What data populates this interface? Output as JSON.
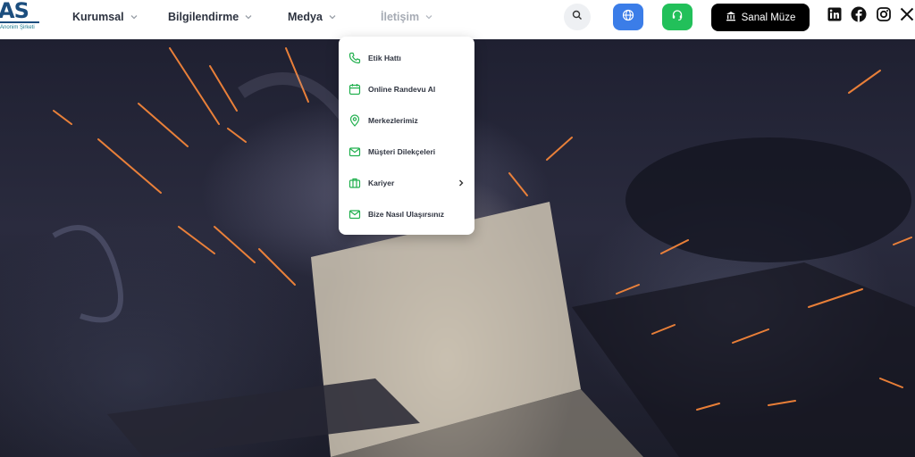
{
  "brand": {
    "logo_mark": "AS",
    "logo_sub": "Anonim Şirketi"
  },
  "nav": {
    "items": [
      {
        "label": "Kurumsal"
      },
      {
        "label": "Bilgilendirme"
      },
      {
        "label": "Medya"
      },
      {
        "label": "İletişim"
      }
    ]
  },
  "header_actions": {
    "museum_label": "Sanal Müze",
    "icons": [
      "search-icon",
      "globe-icon",
      "headset-icon",
      "museum-icon"
    ]
  },
  "social": [
    "linkedin-icon",
    "facebook-icon",
    "instagram-icon",
    "x-icon"
  ],
  "dropdown": {
    "items": [
      {
        "label": "Etik Hattı",
        "icon": "phone-icon"
      },
      {
        "label": "Online Randevu Al",
        "icon": "calendar-icon"
      },
      {
        "label": "Merkezlerimiz",
        "icon": "location-icon"
      },
      {
        "label": "Müşteri Dilekçeleri",
        "icon": "mail-icon"
      },
      {
        "label": "Kariyer",
        "icon": "briefcase-icon"
      },
      {
        "label": "Bize Nasıl Ulaşırsınız",
        "icon": "mail-icon"
      }
    ]
  },
  "colors": {
    "brand": "#1c4e7e",
    "accent_blue": "#3b7de8",
    "accent_green": "#22c05a",
    "menu_icon": "#22b04f"
  }
}
